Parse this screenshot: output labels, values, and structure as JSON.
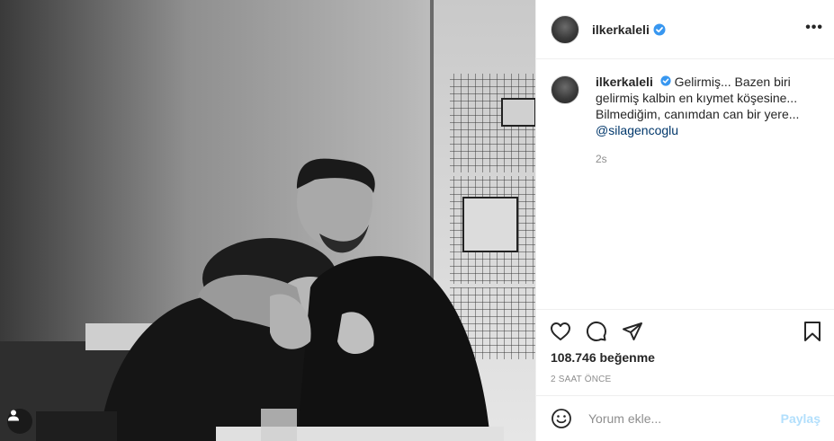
{
  "post": {
    "photo_icon": "photo",
    "user_tag_icon": "user-icon"
  },
  "header": {
    "username": "ilkerkaleli",
    "verified_icon": "verified-badge-icon",
    "more_label": "•••"
  },
  "caption": {
    "username": "ilkerkaleli",
    "text": "Gelirmiş... Bazen biri gelirmiş kalbin en kıymet köşesine... Bilmediğim, canımdan can bir yere...",
    "mention": "@silagencoglu",
    "time": "2s"
  },
  "actions": {
    "like_icon": "heart-icon",
    "comment_icon": "comment-icon",
    "share_icon": "send-icon",
    "save_icon": "bookmark-icon"
  },
  "likes": "108.746 beğenme",
  "timestamp": "2 SAAT ÖNCE",
  "comment_box": {
    "placeholder": "Yorum ekle...",
    "post_label": "Paylaş",
    "emoji_icon": "emoji-icon"
  },
  "colors": {
    "verified": "#3897f0",
    "mention": "#00376b",
    "muted": "#8e8e8e",
    "post_disabled": "#b2dffc"
  }
}
